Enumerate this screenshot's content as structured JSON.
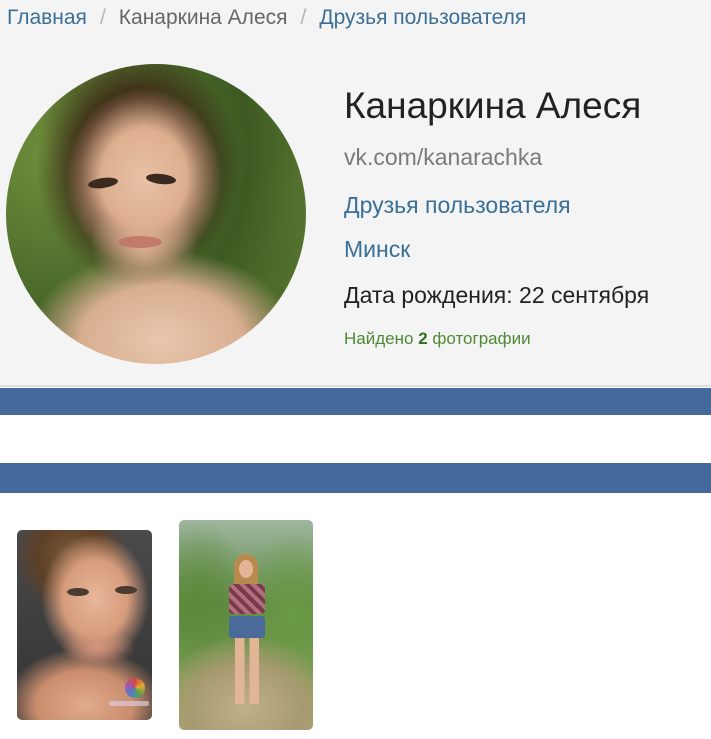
{
  "breadcrumb": {
    "home": "Главная",
    "user": "Канаркина Алеся",
    "friends": "Друзья пользователя",
    "separator": "/"
  },
  "profile": {
    "name": "Канаркина Алеся",
    "vk_link": "vk.com/kanarachka",
    "friends_link": "Друзья пользователя",
    "city": "Минск",
    "birth_label": "Дата рождения:",
    "birth_value": "22 сентября"
  },
  "found": {
    "prefix": "Найдено",
    "count": "2",
    "suffix": "фотографии"
  },
  "colors": {
    "link": "#3a6f97",
    "band": "#45699a",
    "found_text": "#4e8a34",
    "header_bg": "#f4f4f4"
  },
  "photos": [
    {
      "kind": "portrait"
    },
    {
      "kind": "outdoor"
    }
  ]
}
